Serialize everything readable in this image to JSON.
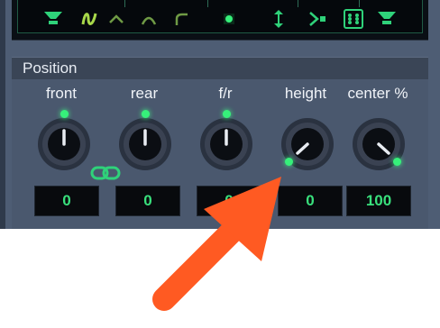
{
  "section": {
    "title": "Position"
  },
  "knobs": [
    {
      "label": "front",
      "value": "0"
    },
    {
      "label": "rear",
      "value": "0"
    },
    {
      "label": "f/r",
      "value": "0"
    },
    {
      "label": "height",
      "value": "0"
    },
    {
      "label": "center %",
      "value": "100"
    }
  ],
  "toolbar": {
    "icons": [
      "speaker-left-icon",
      "squiggle-icon",
      "caret-up-icon",
      "arc-icon",
      "corner-curve-icon",
      "dot-icon",
      "vertical-arrows-icon",
      "split-arrow-icon",
      "grid-box-icon",
      "speaker-right-icon"
    ]
  },
  "colors": {
    "accent": "#39e07c",
    "arrow": "#ff5a22",
    "panel": "#4a586e"
  }
}
